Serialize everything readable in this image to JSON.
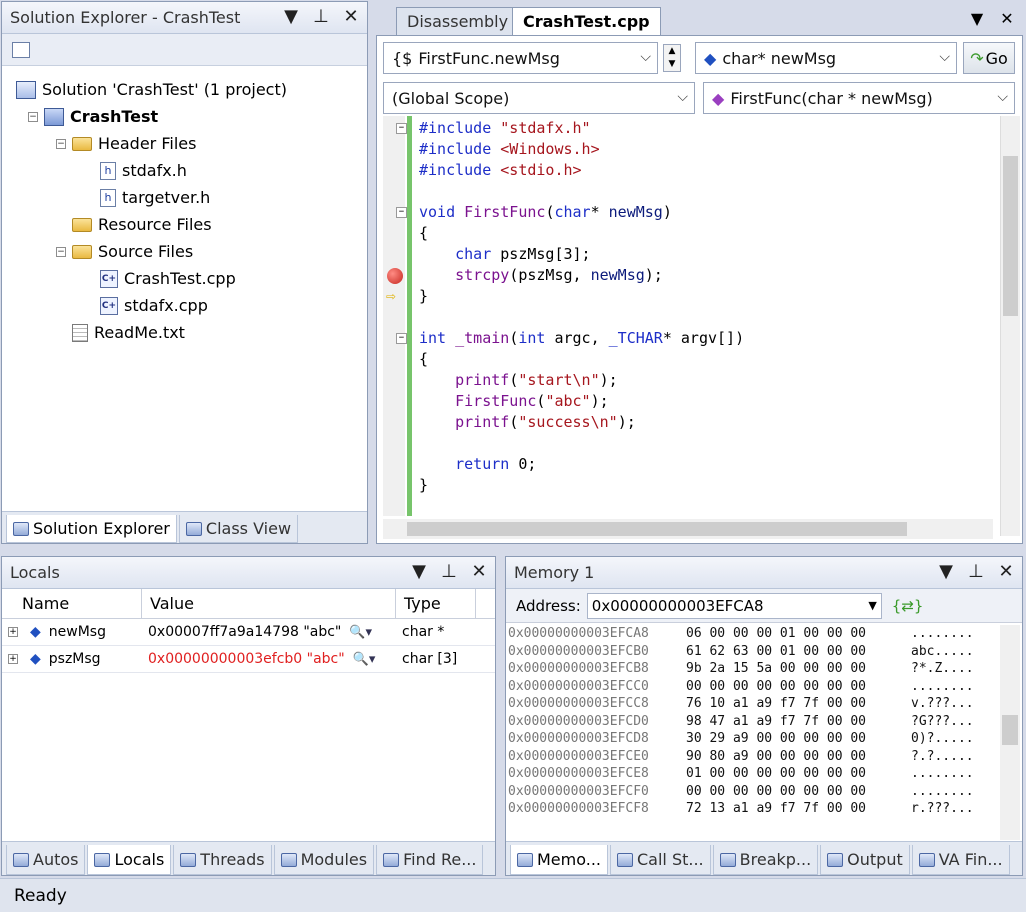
{
  "solution_explorer": {
    "title": "Solution Explorer - CrashTest",
    "tree": [
      {
        "label": "Solution 'CrashTest' (1 project)",
        "indent": 0,
        "icon": "solution-icon",
        "bold": false
      },
      {
        "label": "CrashTest",
        "indent": 1,
        "icon": "project-icon",
        "bold": true,
        "exp": "−"
      },
      {
        "label": "Header Files",
        "indent": 2,
        "icon": "folder-icon",
        "exp": "−"
      },
      {
        "label": "stdafx.h",
        "indent": 3,
        "icon": "header-file-icon"
      },
      {
        "label": "targetver.h",
        "indent": 3,
        "icon": "header-file-icon"
      },
      {
        "label": "Resource Files",
        "indent": 2,
        "icon": "folder-icon"
      },
      {
        "label": "Source Files",
        "indent": 2,
        "icon": "folder-icon",
        "exp": "−"
      },
      {
        "label": "CrashTest.cpp",
        "indent": 3,
        "icon": "cpp-file-icon"
      },
      {
        "label": "stdafx.cpp",
        "indent": 3,
        "icon": "cpp-file-icon"
      },
      {
        "label": "ReadMe.txt",
        "indent": 2,
        "icon": "text-file-icon"
      }
    ],
    "tabs": [
      "Solution Explorer",
      "Class View"
    ]
  },
  "editor": {
    "tabs": [
      "Disassembly",
      "CrashTest.cpp"
    ],
    "member_combo": "FirstFunc.newMsg",
    "type_combo": "char* newMsg",
    "go_label": "Go",
    "scope_combo": "(Global Scope)",
    "function_combo": "FirstFunc(char * newMsg)"
  },
  "code": [
    [
      {
        "t": "#include ",
        "c": "kw"
      },
      {
        "t": "\"stdafx.h\"",
        "c": "str"
      }
    ],
    [
      {
        "t": "#include ",
        "c": "kw"
      },
      {
        "t": "<Windows.h>",
        "c": "str"
      }
    ],
    [
      {
        "t": "#include ",
        "c": "kw"
      },
      {
        "t": "<stdio.h>",
        "c": "str"
      }
    ],
    [],
    [
      {
        "t": "void ",
        "c": "kw"
      },
      {
        "t": "FirstFunc",
        "c": "fn"
      },
      {
        "t": "(",
        "c": ""
      },
      {
        "t": "char",
        "c": "kw"
      },
      {
        "t": "* ",
        "c": ""
      },
      {
        "t": "newMsg",
        "c": "var"
      },
      {
        "t": ")",
        "c": ""
      }
    ],
    [
      {
        "t": "{",
        "c": ""
      }
    ],
    [
      {
        "t": "    char ",
        "c": "kw"
      },
      {
        "t": "pszMsg[3];",
        "c": ""
      }
    ],
    [
      {
        "t": "    strcpy",
        "c": "fn"
      },
      {
        "t": "(pszMsg, ",
        "c": ""
      },
      {
        "t": "newMsg",
        "c": "var"
      },
      {
        "t": ");",
        "c": ""
      }
    ],
    [
      {
        "t": "}",
        "c": ""
      }
    ],
    [],
    [
      {
        "t": "int ",
        "c": "kw"
      },
      {
        "t": "_tmain",
        "c": "fn"
      },
      {
        "t": "(",
        "c": ""
      },
      {
        "t": "int ",
        "c": "kw"
      },
      {
        "t": "argc, ",
        "c": ""
      },
      {
        "t": "_TCHAR",
        "c": "kw"
      },
      {
        "t": "* argv[])",
        "c": ""
      }
    ],
    [
      {
        "t": "{",
        "c": ""
      }
    ],
    [
      {
        "t": "    printf",
        "c": "fn"
      },
      {
        "t": "(",
        "c": ""
      },
      {
        "t": "\"start\\n\"",
        "c": "str"
      },
      {
        "t": ");",
        "c": ""
      }
    ],
    [
      {
        "t": "    FirstFunc",
        "c": "fn"
      },
      {
        "t": "(",
        "c": ""
      },
      {
        "t": "\"abc\"",
        "c": "str"
      },
      {
        "t": ");",
        "c": ""
      }
    ],
    [
      {
        "t": "    printf",
        "c": "fn"
      },
      {
        "t": "(",
        "c": ""
      },
      {
        "t": "\"success\\n\"",
        "c": "str"
      },
      {
        "t": ");",
        "c": ""
      }
    ],
    [],
    [
      {
        "t": "    return ",
        "c": "kw"
      },
      {
        "t": "0;",
        "c": ""
      }
    ],
    [
      {
        "t": "}",
        "c": ""
      }
    ]
  ],
  "locals": {
    "title": "Locals",
    "columns": [
      "Name",
      "Value",
      "Type"
    ],
    "rows": [
      {
        "name": "newMsg",
        "value": "0x00007ff7a9a14798 \"abc\"",
        "type": "char *",
        "changed": false
      },
      {
        "name": "pszMsg",
        "value": "0x00000000003efcb0 \"abc\"",
        "type": "char [3]",
        "changed": true
      }
    ],
    "tabs": [
      "Autos",
      "Locals",
      "Threads",
      "Modules",
      "Find Re..."
    ]
  },
  "memory": {
    "title": "Memory 1",
    "address_label": "Address:",
    "address_value": "0x00000000003EFCA8",
    "lines": [
      {
        "addr": "0x00000000003EFCA8",
        "hex": "06 00 00 00 01 00 00 00",
        "ascii": "........"
      },
      {
        "addr": "0x00000000003EFCB0",
        "hex": "61 62 63 00 01 00 00 00",
        "ascii": "abc....."
      },
      {
        "addr": "0x00000000003EFCB8",
        "hex": "9b 2a 15 5a 00 00 00 00",
        "ascii": "?*.Z...."
      },
      {
        "addr": "0x00000000003EFCC0",
        "hex": "00 00 00 00 00 00 00 00",
        "ascii": "........"
      },
      {
        "addr": "0x00000000003EFCC8",
        "hex": "76 10 a1 a9 f7 7f 00 00",
        "ascii": "v.???..."
      },
      {
        "addr": "0x00000000003EFCD0",
        "hex": "98 47 a1 a9 f7 7f 00 00",
        "ascii": "?G???..."
      },
      {
        "addr": "0x00000000003EFCD8",
        "hex": "30 29 a9 00 00 00 00 00",
        "ascii": "0)?....."
      },
      {
        "addr": "0x00000000003EFCE0",
        "hex": "90 80 a9 00 00 00 00 00",
        "ascii": "?.?....."
      },
      {
        "addr": "0x00000000003EFCE8",
        "hex": "01 00 00 00 00 00 00 00",
        "ascii": "........"
      },
      {
        "addr": "0x00000000003EFCF0",
        "hex": "00 00 00 00 00 00 00 00",
        "ascii": "........"
      },
      {
        "addr": "0x00000000003EFCF8",
        "hex": "72 13 a1 a9 f7 7f 00 00",
        "ascii": "r.???..."
      }
    ],
    "tabs": [
      "Memo...",
      "Call St...",
      "Breakp...",
      "Output",
      "VA Fin..."
    ]
  },
  "status": "Ready"
}
